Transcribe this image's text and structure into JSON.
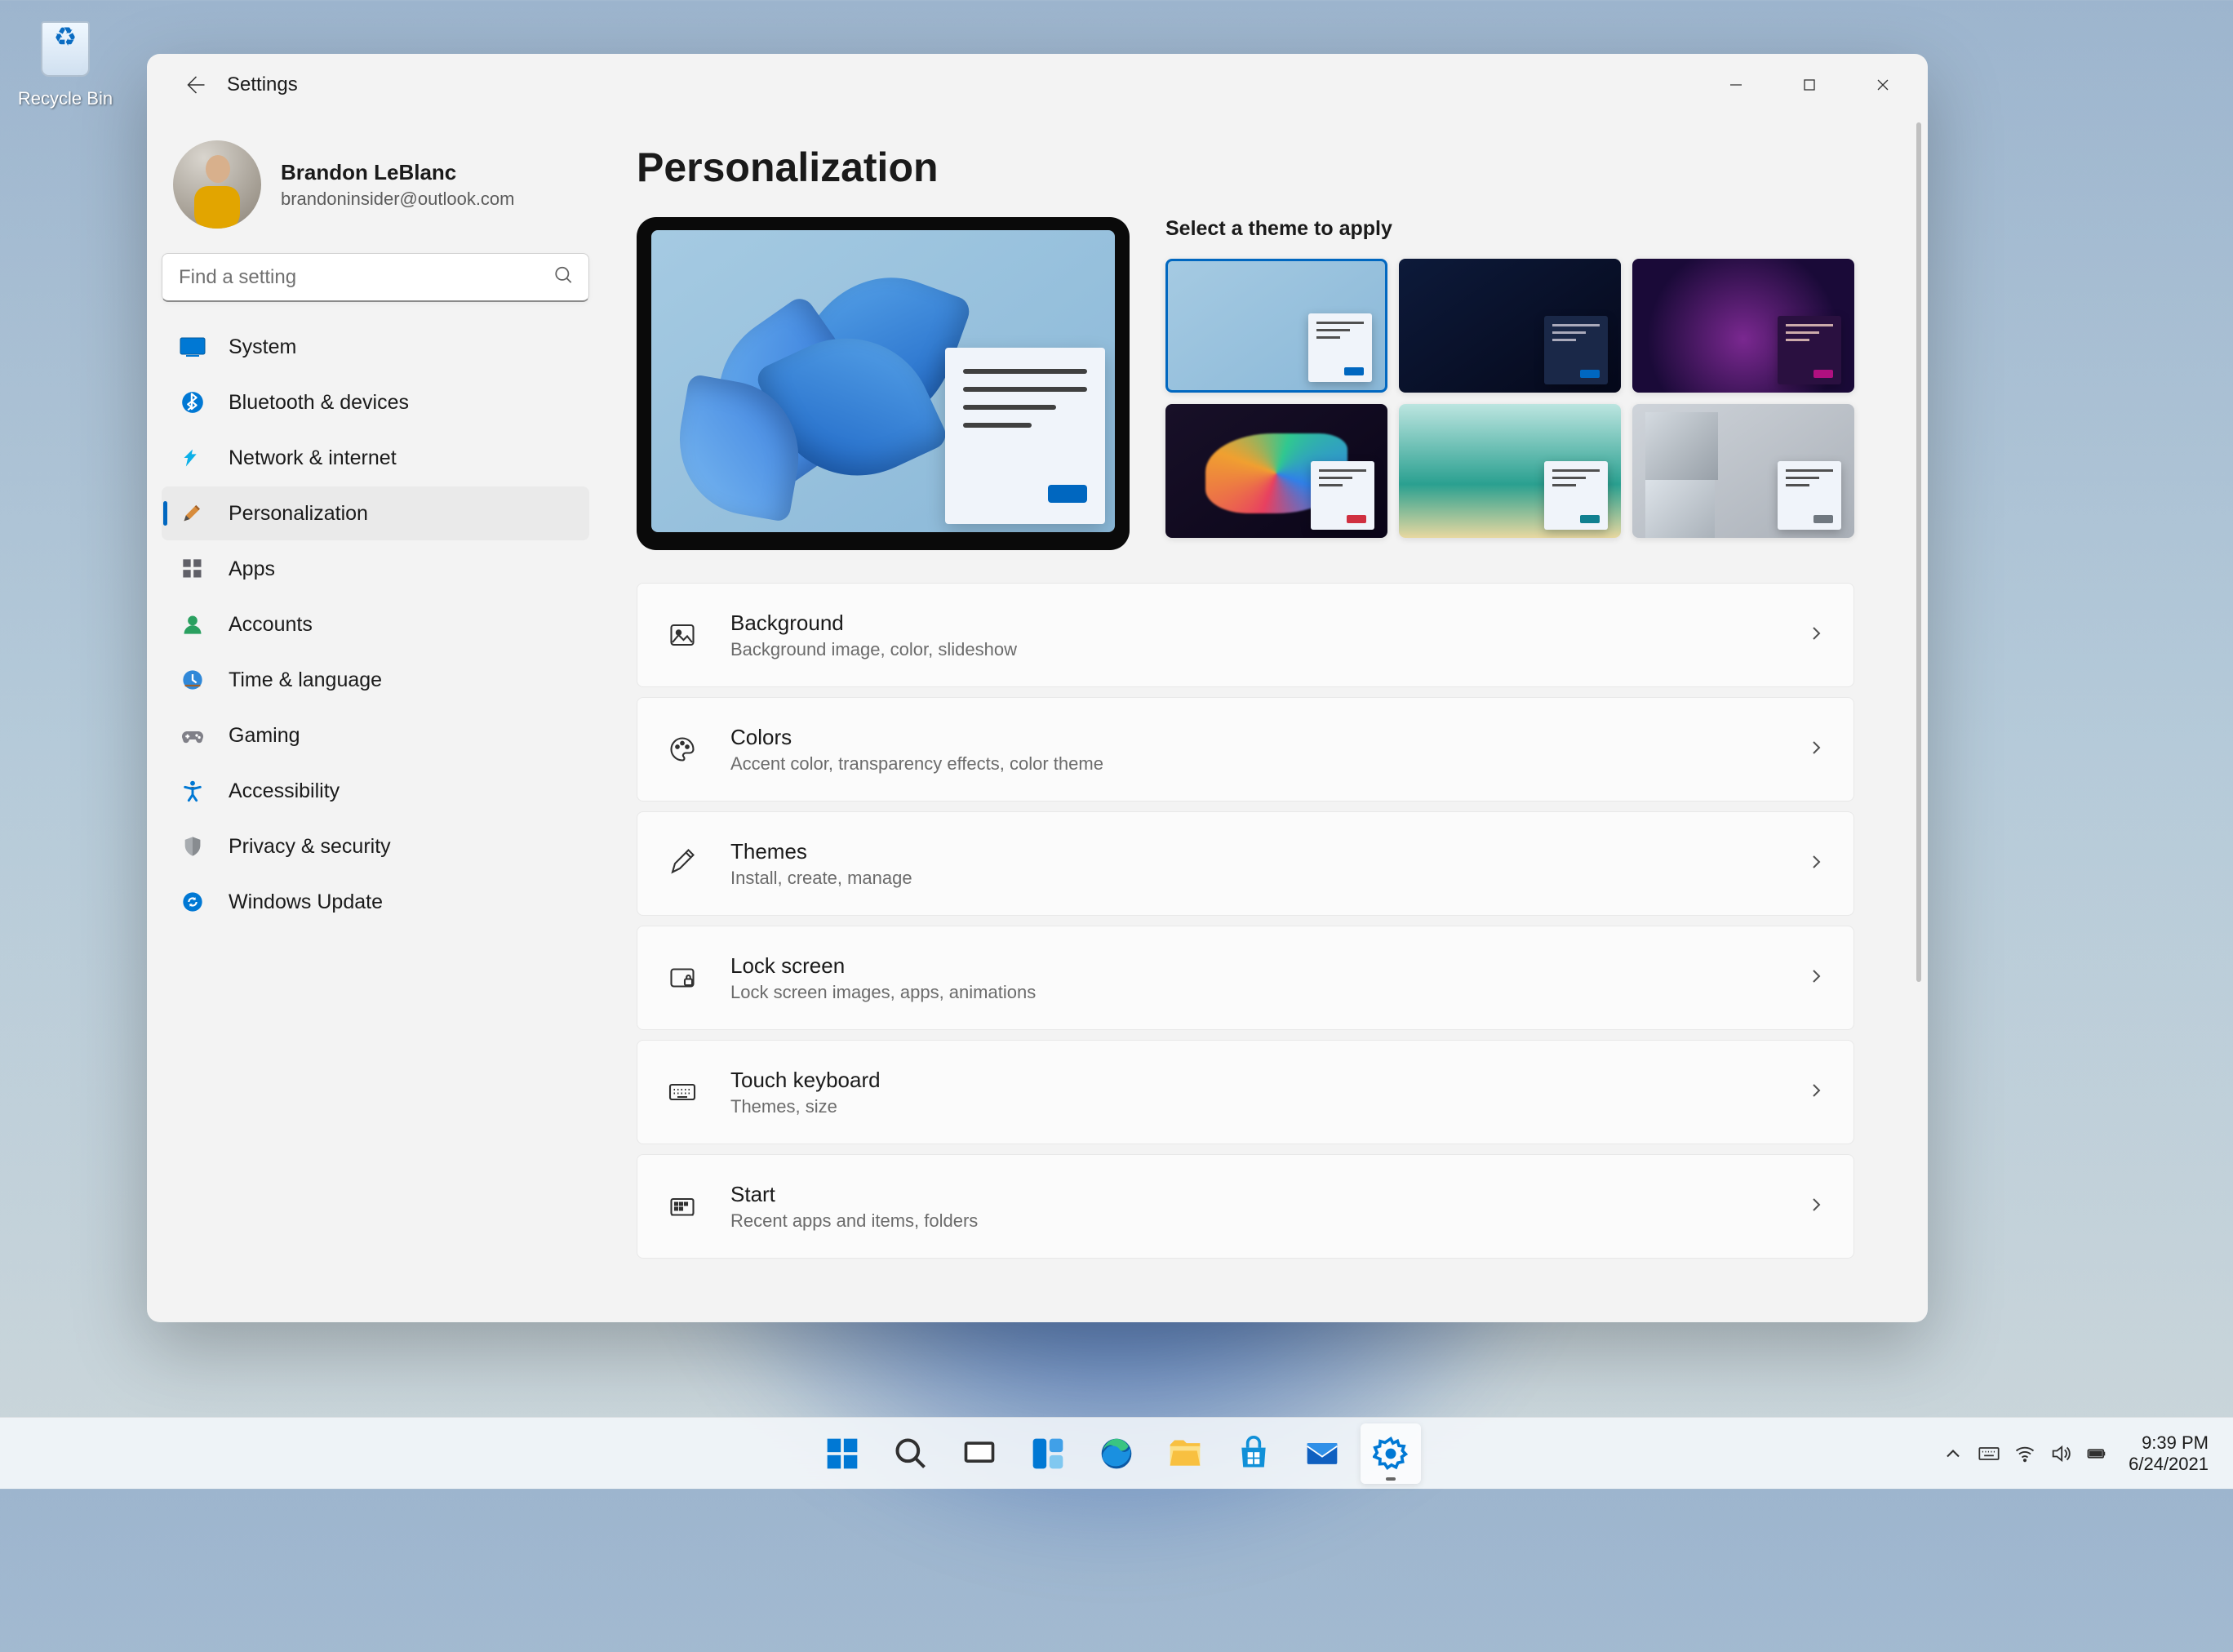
{
  "desktop": {
    "recycle_bin": "Recycle Bin"
  },
  "window": {
    "app_title": "Settings",
    "user_name": "Brandon LeBlanc",
    "user_email": "brandoninsider@outlook.com",
    "search_placeholder": "Find a setting"
  },
  "nav": [
    {
      "key": "system",
      "label": "System"
    },
    {
      "key": "bluetooth",
      "label": "Bluetooth & devices"
    },
    {
      "key": "network",
      "label": "Network & internet"
    },
    {
      "key": "personalization",
      "label": "Personalization",
      "active": true
    },
    {
      "key": "apps",
      "label": "Apps"
    },
    {
      "key": "accounts",
      "label": "Accounts"
    },
    {
      "key": "time",
      "label": "Time & language"
    },
    {
      "key": "gaming",
      "label": "Gaming"
    },
    {
      "key": "accessibility",
      "label": "Accessibility"
    },
    {
      "key": "privacy",
      "label": "Privacy & security"
    },
    {
      "key": "update",
      "label": "Windows Update"
    }
  ],
  "page": {
    "title": "Personalization",
    "themes_title": "Select a theme to apply"
  },
  "theme_accents": [
    "#0067c0",
    "#0067c0",
    "#b01080",
    "#d03040",
    "#108090",
    "#707880"
  ],
  "rows": [
    {
      "key": "background",
      "title": "Background",
      "sub": "Background image, color, slideshow"
    },
    {
      "key": "colors",
      "title": "Colors",
      "sub": "Accent color, transparency effects, color theme"
    },
    {
      "key": "themes",
      "title": "Themes",
      "sub": "Install, create, manage"
    },
    {
      "key": "lock",
      "title": "Lock screen",
      "sub": "Lock screen images, apps, animations"
    },
    {
      "key": "touchkb",
      "title": "Touch keyboard",
      "sub": "Themes, size"
    },
    {
      "key": "start",
      "title": "Start",
      "sub": "Recent apps and items, folders"
    }
  ],
  "taskbar": {
    "time": "9:39 PM",
    "date": "6/24/2021"
  }
}
